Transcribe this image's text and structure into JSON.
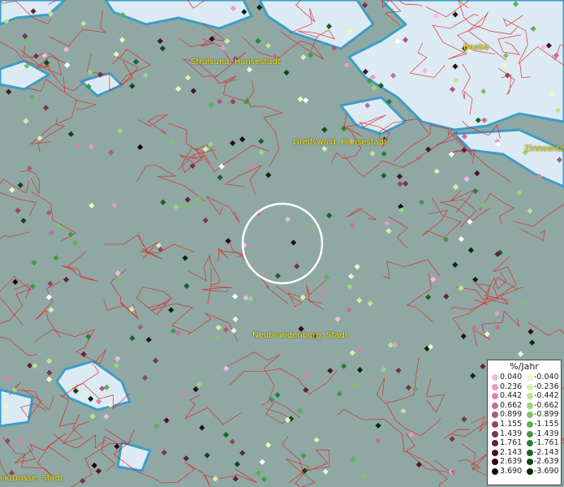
{
  "places": [
    {
      "name": "Stralsund, Hansestadt",
      "key": "stralsund"
    },
    {
      "name": "Baabe",
      "key": "baabe"
    },
    {
      "name": "Greifswald, Hansestadt",
      "key": "greifswald"
    },
    {
      "name": "Zinnowitz",
      "key": "zinnowitz"
    },
    {
      "name": "Neubrandenburg, Stadt",
      "key": "neubrandenburg"
    },
    {
      "name": "ck/Dosse, Stadt",
      "key": "dosse"
    }
  ],
  "legend": {
    "title": "%/Jahr",
    "positive": [
      {
        "value": "0.040",
        "color": "#f4b8e6"
      },
      {
        "value": "0.236",
        "color": "#e89acb"
      },
      {
        "value": "0.442",
        "color": "#d884b0"
      },
      {
        "value": "0.662",
        "color": "#c46e96"
      },
      {
        "value": "0.899",
        "color": "#ac5a7c"
      },
      {
        "value": "1.155",
        "color": "#924663"
      },
      {
        "value": "1.439",
        "color": "#78344c"
      },
      {
        "value": "1.761",
        "color": "#5e2337"
      },
      {
        "value": "2.143",
        "color": "#461525"
      },
      {
        "value": "2.639",
        "color": "#2e0a16"
      },
      {
        "value": "3.690",
        "color": "#16030a"
      }
    ],
    "negative": [
      {
        "value": "-0.040",
        "color": "#eef7c8"
      },
      {
        "value": "-0.236",
        "color": "#d9eeac"
      },
      {
        "value": "-0.442",
        "color": "#bfe394"
      },
      {
        "value": "-0.662",
        "color": "#9fd47e"
      },
      {
        "value": "-0.899",
        "color": "#7fc26a"
      },
      {
        "value": "-1.155",
        "color": "#5fae58"
      },
      {
        "value": "-1.439",
        "color": "#429846"
      },
      {
        "value": "-1.761",
        "color": "#2a7f36"
      },
      {
        "value": "-2.143",
        "color": "#176426"
      },
      {
        "value": "-2.639",
        "color": "#0a4818"
      },
      {
        "value": "-3.690",
        "color": "#032a0b"
      }
    ]
  },
  "colors": {
    "land": "#8fa8a4",
    "water": "#dcebf3",
    "coast": "#3e9cc7",
    "borders": "#e02020",
    "labels": "#f2e81c",
    "highlight": "#ffffff"
  }
}
